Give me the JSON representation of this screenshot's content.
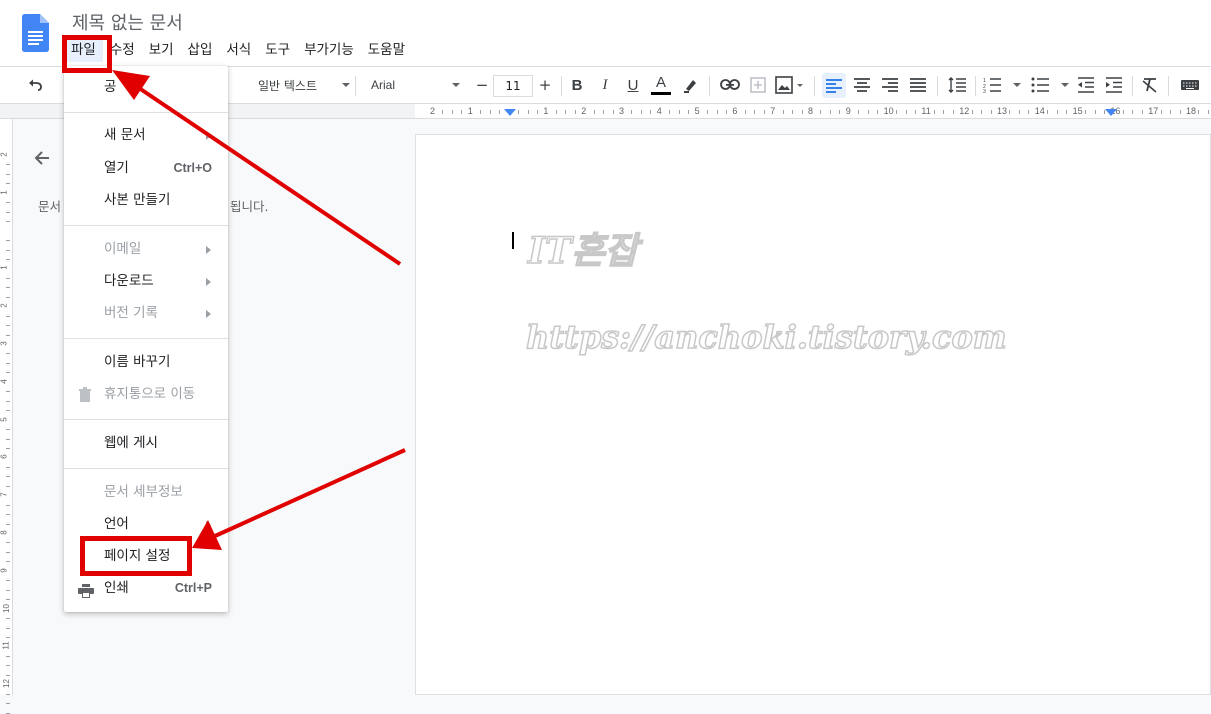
{
  "doc": {
    "title": "제목 없는 문서"
  },
  "menubar": [
    "파일",
    "수정",
    "보기",
    "삽입",
    "서식",
    "도구",
    "부가기능",
    "도움말"
  ],
  "toolbar": {
    "style": "일반 텍스트",
    "font": "Arial",
    "font_size": "11",
    "minus": "−",
    "plus": "+",
    "bold": "B",
    "italic": "I",
    "underline": "U",
    "text_color_letter": "A"
  },
  "ruler": {
    "marks": [
      "2",
      "1",
      "",
      "1",
      "2",
      "3",
      "4",
      "5",
      "6",
      "7",
      "8",
      "9",
      "10",
      "11",
      "12",
      "13",
      "14",
      "15",
      "16",
      "17",
      "18"
    ]
  },
  "vruler": {
    "marks": [
      "2",
      "1",
      "",
      "1",
      "2",
      "3",
      "4",
      "5",
      "6",
      "7",
      "8",
      "9",
      "10",
      "11",
      "12"
    ]
  },
  "outline": {
    "text_left": "문서",
    "text_right": "됩니다."
  },
  "file_menu": {
    "items": [
      {
        "label": "공",
        "disabled": false
      },
      {
        "label": "새 문서",
        "disabled": false,
        "submenu": true
      },
      {
        "label": "열기",
        "shortcut": "Ctrl+O",
        "disabled": false
      },
      {
        "label": "사본 만들기",
        "disabled": false
      },
      {
        "label": "이메일",
        "disabled": true,
        "submenu": true
      },
      {
        "label": "다운로드",
        "disabled": false,
        "submenu": true
      },
      {
        "label": "버전 기록",
        "disabled": true,
        "submenu": true
      },
      {
        "label": "이름 바꾸기",
        "disabled": false
      },
      {
        "label": "휴지통으로 이동",
        "disabled": true,
        "icon": "trash-icon"
      },
      {
        "label": "웹에 게시",
        "disabled": false
      },
      {
        "label": "문서 세부정보",
        "disabled": true
      },
      {
        "label": "언어",
        "disabled": false,
        "submenu": true
      },
      {
        "label": "페이지 설정",
        "disabled": false
      },
      {
        "label": "인쇄",
        "shortcut": "Ctrl+P",
        "disabled": false,
        "icon": "print-icon"
      }
    ]
  },
  "watermark": {
    "line1": "IT혼잡",
    "line2": "https://anchoki.tistory.com"
  },
  "colors": {
    "annotation_red": "#e00000",
    "doc_blue": "#4285f4",
    "active_blue": "#1a73e8"
  }
}
